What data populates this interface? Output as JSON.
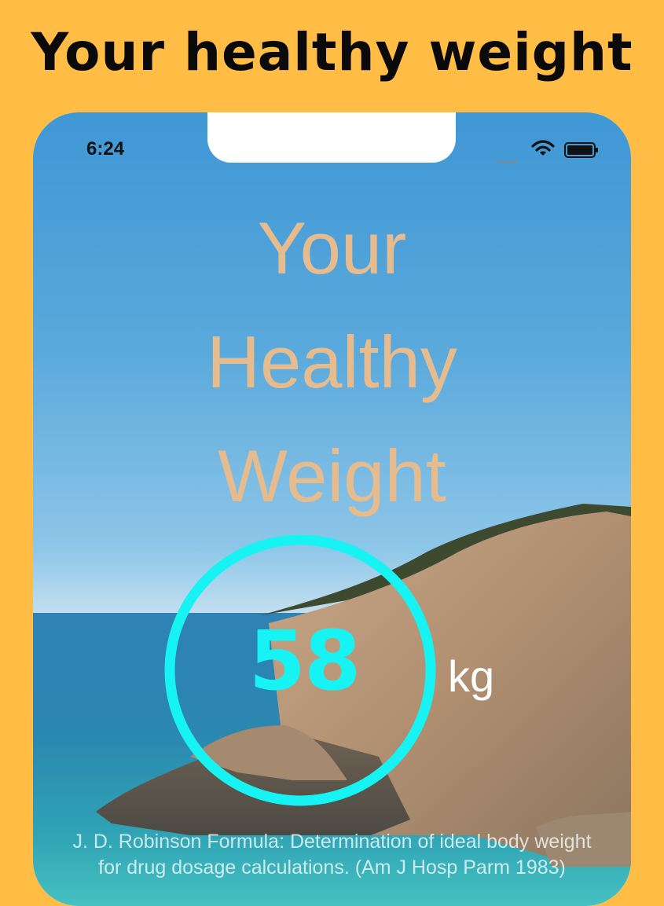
{
  "promo": {
    "title": "Your healthy weight"
  },
  "status_bar": {
    "time": "6:24"
  },
  "hero": {
    "line1": "Your",
    "line2": "Healthy",
    "line3": "Weight"
  },
  "result": {
    "value": "58",
    "unit": "kg"
  },
  "footer": {
    "line1": "J. D. Robinson Formula: Determination of ideal body weight",
    "line2": "for drug dosage calculations. (Am J Hosp Parm 1983)"
  },
  "colors": {
    "background": "#FFBD45",
    "accent": "#17F3F3",
    "title_text": "#E6BC8E"
  },
  "icons": [
    "signal-icon",
    "wifi-icon",
    "battery-icon"
  ]
}
